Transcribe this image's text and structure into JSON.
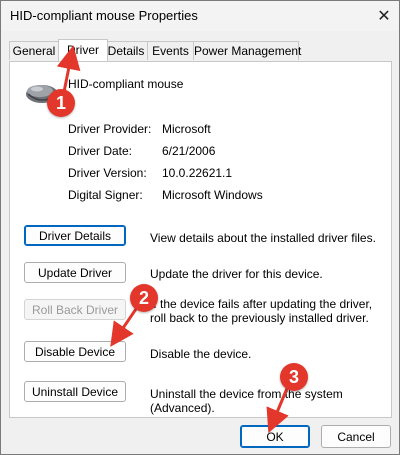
{
  "window": {
    "title": "HID-compliant mouse Properties",
    "close_glyph": "✕"
  },
  "tabs": [
    {
      "label": "General",
      "active": false
    },
    {
      "label": "Driver",
      "active": true
    },
    {
      "label": "Details",
      "active": false
    },
    {
      "label": "Events",
      "active": false
    },
    {
      "label": "Power Management",
      "active": false
    }
  ],
  "device": {
    "name": "HID-compliant mouse",
    "icon": "mouse-icon"
  },
  "info": [
    {
      "label": "Driver Provider:",
      "value": "Microsoft"
    },
    {
      "label": "Driver Date:",
      "value": "6/21/2006"
    },
    {
      "label": "Driver Version:",
      "value": "10.0.22621.1"
    },
    {
      "label": "Digital Signer:",
      "value": "Microsoft Windows"
    }
  ],
  "actions": [
    {
      "label": "Driver Details",
      "desc": "View details about the installed driver files.",
      "enabled": true
    },
    {
      "label": "Update Driver",
      "desc": "Update the driver for this device.",
      "enabled": true
    },
    {
      "label": "Roll Back Driver",
      "desc": "If the device fails after updating the driver, roll back to the previously installed driver.",
      "enabled": false
    },
    {
      "label": "Disable Device",
      "desc": "Disable the device.",
      "enabled": true
    },
    {
      "label": "Uninstall Device",
      "desc": "Uninstall the device from the system (Advanced).",
      "enabled": true
    }
  ],
  "footer": {
    "ok_label": "OK",
    "cancel_label": "Cancel"
  },
  "annotations": {
    "badge_1": "1",
    "badge_2": "2",
    "badge_3": "3",
    "color": "#e2372a"
  }
}
